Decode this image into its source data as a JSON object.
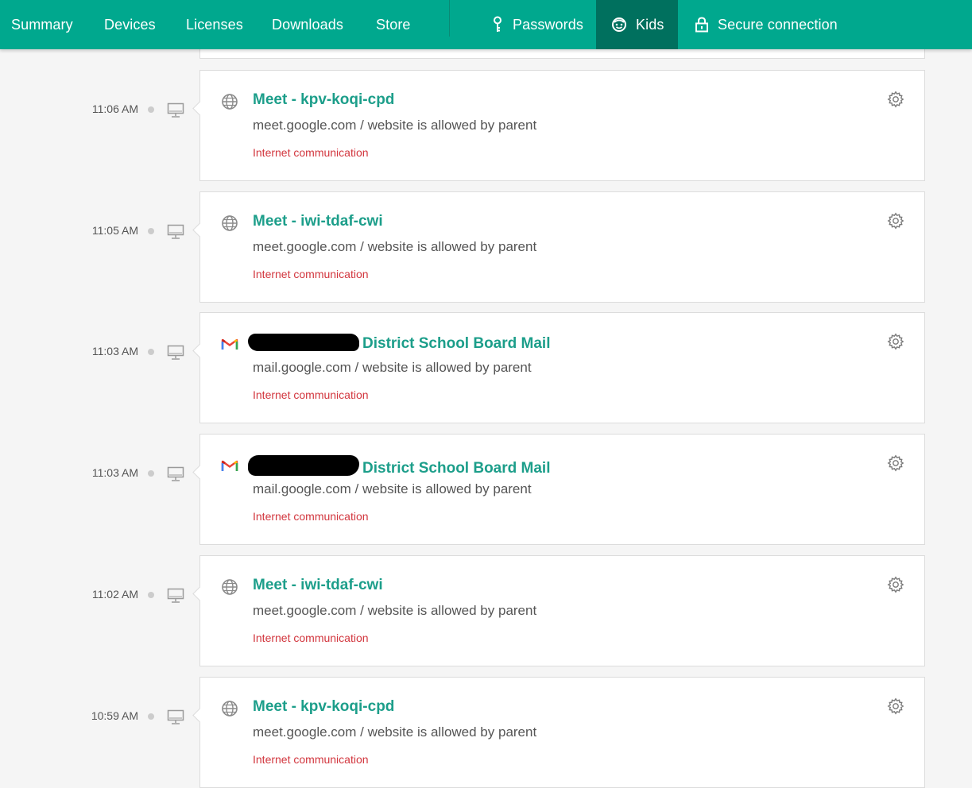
{
  "nav": {
    "items": [
      {
        "label": "Summary"
      },
      {
        "label": "Devices"
      },
      {
        "label": "Licenses"
      },
      {
        "label": "Downloads"
      },
      {
        "label": "Store"
      }
    ],
    "right_items": [
      {
        "label": "Passwords",
        "icon": "key-icon"
      },
      {
        "label": "Kids",
        "icon": "kid-face-icon",
        "active": true
      },
      {
        "label": "Secure connection",
        "icon": "lock-icon"
      }
    ],
    "colors": {
      "bar": "#00a88e",
      "active": "#00705e"
    }
  },
  "events": [
    {
      "time": "11:06 AM",
      "icon": "globe-icon",
      "title": "Meet - kpv-koqi-cpd",
      "subtitle": "meet.google.com / website is allowed by parent",
      "category": "Internet communication"
    },
    {
      "time": "11:05 AM",
      "icon": "globe-icon",
      "title": "Meet - iwi-tdaf-cwi",
      "subtitle": "meet.google.com / website is allowed by parent",
      "category": "Internet communication"
    },
    {
      "time": "11:03 AM",
      "icon": "gmail-icon",
      "title": "District School Board Mail",
      "redacted_prefix": true,
      "subtitle": "mail.google.com / website is allowed by parent",
      "category": "Internet communication"
    },
    {
      "time": "11:03 AM",
      "icon": "gmail-icon",
      "title": "District School Board Mail",
      "redacted_prefix": true,
      "subtitle": "mail.google.com / website is allowed by parent",
      "category": "Internet communication"
    },
    {
      "time": "11:02 AM",
      "icon": "globe-icon",
      "title": "Meet - iwi-tdaf-cwi",
      "subtitle": "meet.google.com / website is allowed by parent",
      "category": "Internet communication"
    },
    {
      "time": "10:59 AM",
      "icon": "globe-icon",
      "title": "Meet - kpv-koqi-cpd",
      "subtitle": "meet.google.com / website is allowed by parent",
      "category": "Internet communication"
    }
  ],
  "colors": {
    "title": "#1c9e8a",
    "category": "#d2363e"
  }
}
